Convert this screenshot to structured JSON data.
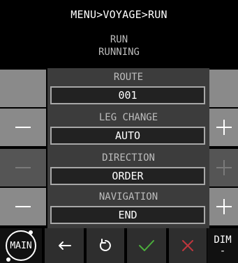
{
  "breadcrumb": "MENU>VOYAGE>RUN",
  "status": {
    "line1": "RUN",
    "line2": "RUNNING"
  },
  "params": [
    {
      "label": "ROUTE",
      "value": "001"
    },
    {
      "label": "LEG CHANGE",
      "value": "AUTO"
    },
    {
      "label": "DIRECTION",
      "value": "ORDER"
    },
    {
      "label": "NAVIGATION",
      "value": "END"
    }
  ],
  "toolbar": {
    "main_label": "MAIN",
    "dim_label": "DIM",
    "dim_value": "-"
  },
  "icons": {
    "back": "left-arrow-icon",
    "reset": "refresh-icon",
    "confirm": "check-icon",
    "cancel": "x-icon"
  },
  "colors": {
    "confirm": "#4caf3c",
    "cancel": "#c0363d"
  }
}
